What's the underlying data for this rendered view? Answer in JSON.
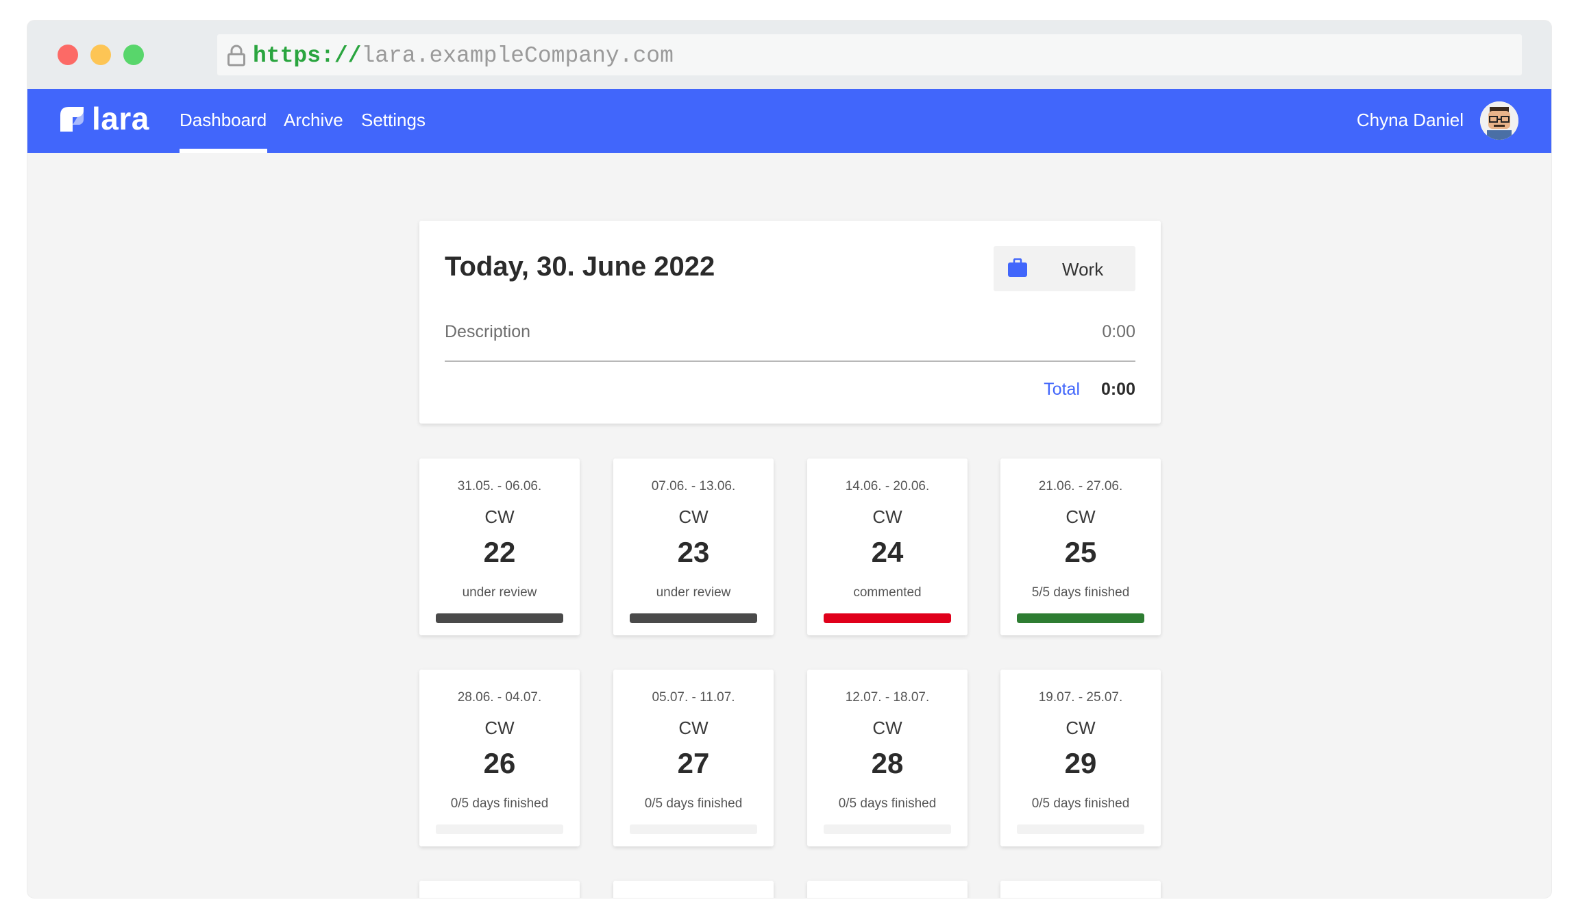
{
  "browser": {
    "url_scheme": "https://",
    "url_host": "lara.exampleCompany.com"
  },
  "nav": {
    "logo_text": "lara",
    "links": [
      "Dashboard",
      "Archive",
      "Settings"
    ],
    "active_link": "Dashboard",
    "user_name": "Chyna Daniel",
    "accent_color": "#4166fb"
  },
  "today": {
    "title": "Today, 30. June 2022",
    "work_button_label": "Work",
    "description_label": "Description",
    "description_time": "0:00",
    "total_label": "Total",
    "total_value": "0:00"
  },
  "weeks": [
    {
      "range": "31.05. - 06.06.",
      "cw_label": "CW",
      "number": "22",
      "status": "under review",
      "progress": 1.0,
      "bar_color": "#4a4a4a"
    },
    {
      "range": "07.06. - 13.06.",
      "cw_label": "CW",
      "number": "23",
      "status": "under review",
      "progress": 1.0,
      "bar_color": "#4a4a4a"
    },
    {
      "range": "14.06. - 20.06.",
      "cw_label": "CW",
      "number": "24",
      "status": "commented",
      "progress": 1.0,
      "bar_color": "#e0001b"
    },
    {
      "range": "21.06. - 27.06.",
      "cw_label": "CW",
      "number": "25",
      "status": "5/5 days finished",
      "progress": 1.0,
      "bar_color": "#2e7d32"
    },
    {
      "range": "28.06. - 04.07.",
      "cw_label": "CW",
      "number": "26",
      "status": "0/5 days finished",
      "progress": 0.0,
      "bar_color": "#2e7d32"
    },
    {
      "range": "05.07. - 11.07.",
      "cw_label": "CW",
      "number": "27",
      "status": "0/5 days finished",
      "progress": 0.0,
      "bar_color": "#2e7d32"
    },
    {
      "range": "12.07. - 18.07.",
      "cw_label": "CW",
      "number": "28",
      "status": "0/5 days finished",
      "progress": 0.0,
      "bar_color": "#2e7d32"
    },
    {
      "range": "19.07. - 25.07.",
      "cw_label": "CW",
      "number": "29",
      "status": "0/5 days finished",
      "progress": 0.0,
      "bar_color": "#2e7d32"
    }
  ]
}
